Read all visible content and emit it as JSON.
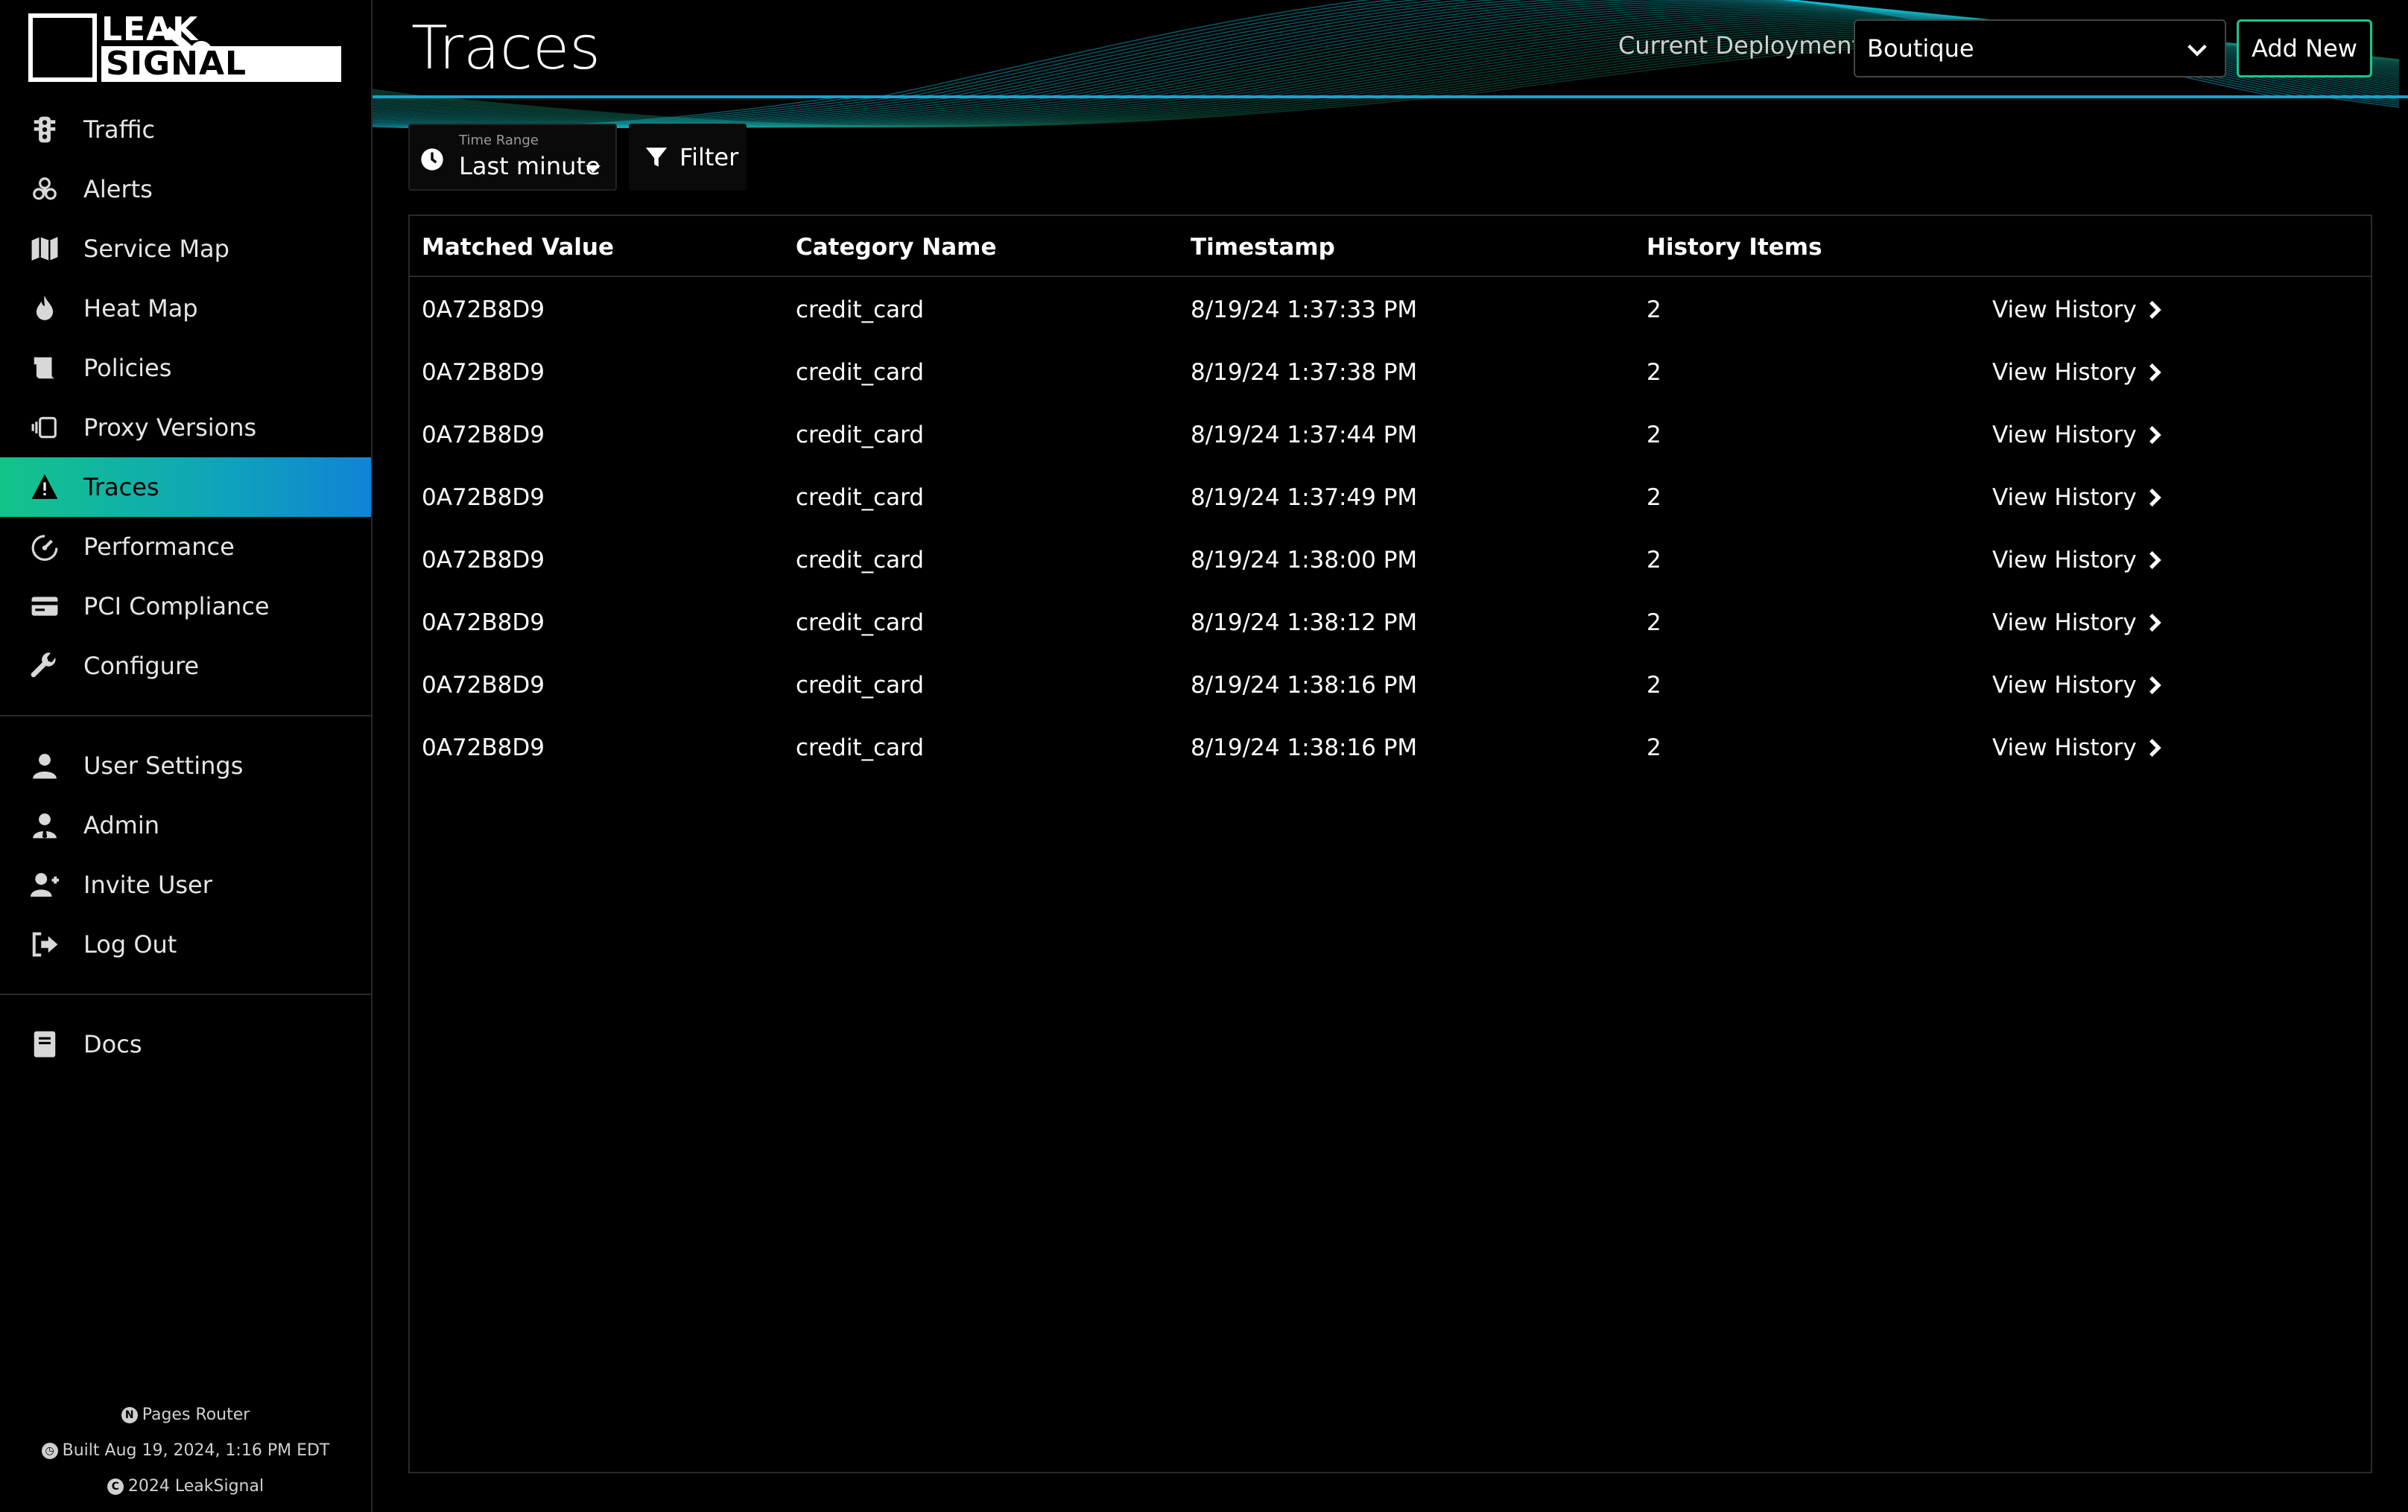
{
  "brand": {
    "line1": "LEAK",
    "line2": "SIGNAL"
  },
  "colors": {
    "accent_green": "#18c790",
    "accent_blue": "#1183d6",
    "header_line": "#1aa3c8"
  },
  "sidebar": {
    "primary": [
      {
        "label": "Traffic",
        "icon": "traffic-light-icon"
      },
      {
        "label": "Alerts",
        "icon": "biohazard-icon"
      },
      {
        "label": "Service Map",
        "icon": "map-icon"
      },
      {
        "label": "Heat Map",
        "icon": "fire-icon"
      },
      {
        "label": "Policies",
        "icon": "scroll-icon"
      },
      {
        "label": "Proxy Versions",
        "icon": "versions-icon"
      },
      {
        "label": "Traces",
        "icon": "warning-icon",
        "active": true
      },
      {
        "label": "Performance",
        "icon": "gauge-icon"
      },
      {
        "label": "PCI Compliance",
        "icon": "credit-card-icon"
      },
      {
        "label": "Configure",
        "icon": "wrench-icon"
      }
    ],
    "secondary": [
      {
        "label": "User Settings",
        "icon": "user-icon"
      },
      {
        "label": "Admin",
        "icon": "user-tie-icon"
      },
      {
        "label": "Invite User",
        "icon": "user-plus-icon"
      },
      {
        "label": "Log Out",
        "icon": "sign-out-icon"
      }
    ],
    "tertiary": [
      {
        "label": "Docs",
        "icon": "book-icon"
      }
    ],
    "footer": {
      "router": "Pages Router",
      "built": "Built Aug 19, 2024, 1:16 PM EDT",
      "copyright": "2024 LeakSignal"
    }
  },
  "header": {
    "title": "Traces",
    "deployment_label": "Current Deployment:",
    "deployment_value": "Boutique",
    "add_new": "Add New"
  },
  "toolbar": {
    "time_range_label": "Time Range",
    "time_range_value": "Last minute",
    "filter_label": "Filter"
  },
  "table": {
    "columns": [
      "Matched Value",
      "Category Name",
      "Timestamp",
      "History Items"
    ],
    "link_label": "View History",
    "rows": [
      {
        "matched": "0A72B8D9",
        "category": "credit_card",
        "timestamp": "8/19/24 1:37:33 PM",
        "history": "2"
      },
      {
        "matched": "0A72B8D9",
        "category": "credit_card",
        "timestamp": "8/19/24 1:37:38 PM",
        "history": "2"
      },
      {
        "matched": "0A72B8D9",
        "category": "credit_card",
        "timestamp": "8/19/24 1:37:44 PM",
        "history": "2"
      },
      {
        "matched": "0A72B8D9",
        "category": "credit_card",
        "timestamp": "8/19/24 1:37:49 PM",
        "history": "2"
      },
      {
        "matched": "0A72B8D9",
        "category": "credit_card",
        "timestamp": "8/19/24 1:38:00 PM",
        "history": "2"
      },
      {
        "matched": "0A72B8D9",
        "category": "credit_card",
        "timestamp": "8/19/24 1:38:12 PM",
        "history": "2"
      },
      {
        "matched": "0A72B8D9",
        "category": "credit_card",
        "timestamp": "8/19/24 1:38:16 PM",
        "history": "2"
      },
      {
        "matched": "0A72B8D9",
        "category": "credit_card",
        "timestamp": "8/19/24 1:38:16 PM",
        "history": "2"
      }
    ]
  }
}
